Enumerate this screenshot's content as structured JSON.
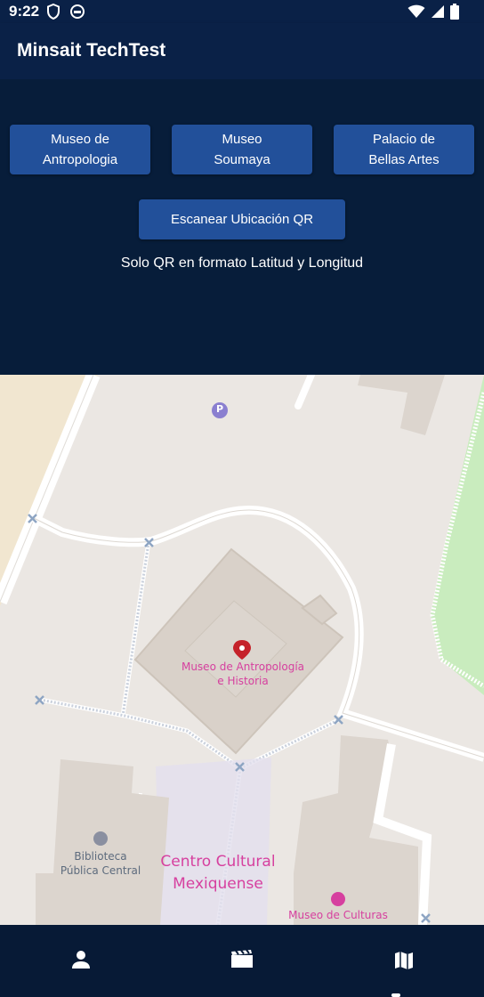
{
  "status_bar": {
    "time": "9:22",
    "left_icons": [
      "shield-icon",
      "circle-app-icon"
    ],
    "right_icons": [
      "wifi-icon",
      "cell-signal-icon",
      "battery-icon"
    ]
  },
  "app_bar": {
    "title": "Minsait TechTest"
  },
  "locations": [
    {
      "label_line1": "Museo de",
      "label_line2": "Antropologia"
    },
    {
      "label_line1": "Museo",
      "label_line2": "Soumaya"
    },
    {
      "label_line1": "Palacio de",
      "label_line2": "Bellas Artes"
    }
  ],
  "scan_button": {
    "label": "Escanear Ubicación QR"
  },
  "hint": "Solo QR en formato Latitud y Longitud",
  "map": {
    "marker_label_line1": "Museo de Antropología",
    "marker_label_line2": "e Historia",
    "library_line1": "Biblioteca",
    "library_line2": "Pública Central",
    "cultural_center_line1": "Centro Cultural",
    "cultural_center_line2": "Mexiquense",
    "museum_cultures": "Museo de Culturas",
    "parking_label": "P",
    "colors": {
      "poi_pink": "#d6409f",
      "marker_red": "#c5222a",
      "park_green": "#c9ecbe",
      "parking_purple": "#8a7fd0"
    }
  },
  "bottom_nav": {
    "items": [
      {
        "icon": "person-icon",
        "active": false
      },
      {
        "icon": "movie-icon",
        "active": false
      },
      {
        "icon": "map-icon",
        "active": true
      }
    ]
  },
  "colors": {
    "app_bar": "#0a2147",
    "content_bg": "#071d3a",
    "button": "#22509a",
    "nav_bg": "#071a36"
  }
}
